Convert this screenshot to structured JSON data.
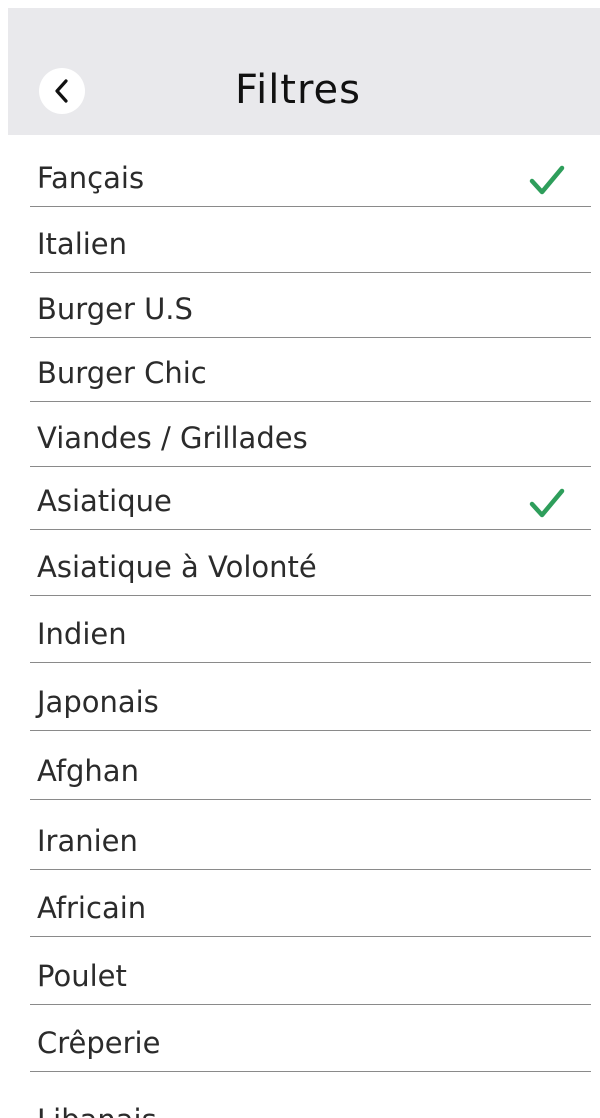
{
  "header": {
    "title": "Filtres",
    "back_icon": "chevron-left-icon"
  },
  "colors": {
    "header_bg": "#e9e9ec",
    "check": "#2e9e5b",
    "divider": "#8a8a8a",
    "text": "#2b2b2b"
  },
  "filters": [
    {
      "label": "Fançais",
      "checked": true
    },
    {
      "label": "Italien",
      "checked": false
    },
    {
      "label": "Burger U.S",
      "checked": false
    },
    {
      "label": "Burger Chic",
      "checked": false
    },
    {
      "label": "Viandes / Grillades",
      "checked": false
    },
    {
      "label": "Asiatique",
      "checked": true
    },
    {
      "label": "Asiatique à Volonté",
      "checked": false
    },
    {
      "label": "Indien",
      "checked": false
    },
    {
      "label": "Japonais",
      "checked": false
    },
    {
      "label": "Afghan",
      "checked": false
    },
    {
      "label": "Iranien",
      "checked": false
    },
    {
      "label": "Africain",
      "checked": false
    },
    {
      "label": "Poulet",
      "checked": false
    },
    {
      "label": "Crêperie",
      "checked": false
    },
    {
      "label": "Libanais",
      "checked": false
    }
  ]
}
